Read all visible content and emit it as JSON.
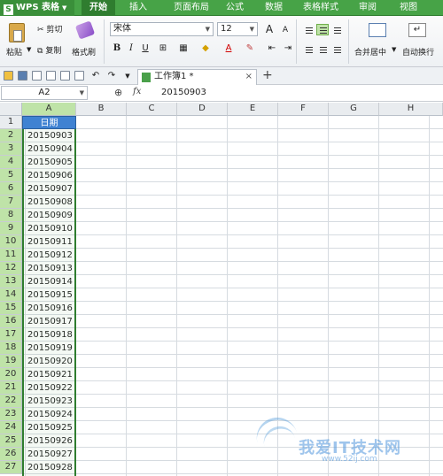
{
  "app": {
    "name": "WPS 表格",
    "logo_letter": "S"
  },
  "menu": {
    "tabs": [
      "开始",
      "插入",
      "页面布局",
      "公式",
      "数据",
      "表格样式",
      "审阅",
      "视图"
    ],
    "active_index": 0
  },
  "ribbon": {
    "cut_label": "剪切",
    "paste_label": "粘贴",
    "copy_label": "复制",
    "format_painter_label": "格式刷",
    "font_name": "宋体",
    "font_size": "12",
    "bold": "B",
    "italic": "I",
    "underline": "U",
    "grow_font": "A",
    "shrink_font": "A",
    "font_color": "A",
    "merge_label": "合并居中",
    "wrap_label": "自动换行",
    "wrap_icon": "↵"
  },
  "document_tab": {
    "title": "工作簿1 *",
    "close": "×",
    "new_tab": "+"
  },
  "formula_bar": {
    "cell_ref": "A2",
    "fx_label": "fx",
    "value": "20150903",
    "zoom_icon": "⊕"
  },
  "grid": {
    "columns": [
      "A",
      "B",
      "C",
      "D",
      "E",
      "F",
      "G",
      "H"
    ],
    "selected_column": "A",
    "rows": [
      "1",
      "2",
      "3",
      "4",
      "5",
      "6",
      "7",
      "8",
      "9",
      "10",
      "11",
      "12",
      "13",
      "14",
      "15",
      "16",
      "17",
      "18",
      "19",
      "20",
      "21",
      "22",
      "23",
      "24",
      "25",
      "26",
      "27"
    ],
    "column_a": [
      "日期",
      "20150903",
      "20150904",
      "20150905",
      "20150906",
      "20150907",
      "20150908",
      "20150909",
      "20150910",
      "20150911",
      "20150912",
      "20150913",
      "20150914",
      "20150915",
      "20150916",
      "20150917",
      "20150918",
      "20150919",
      "20150920",
      "20150921",
      "20150922",
      "20150923",
      "20150924",
      "20150925",
      "20150926",
      "20150927",
      "20150928"
    ]
  },
  "watermark": {
    "text": "我爱IT技术网",
    "url": "www.52ij.com"
  },
  "colors": {
    "accent": "#47a347",
    "header_cell": "#3f82d2",
    "selection": "#bfe3a8"
  }
}
